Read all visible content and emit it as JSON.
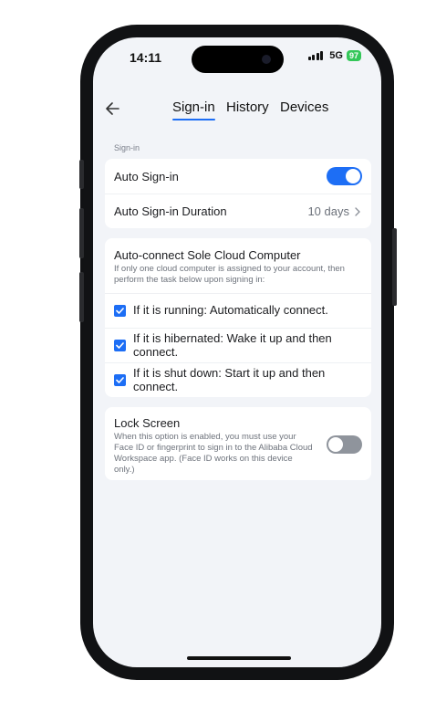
{
  "status_bar": {
    "time": "14:11",
    "network": "5G",
    "battery": "97"
  },
  "nav": {
    "back_icon": "arrow-left-icon",
    "tabs": [
      {
        "label": "Sign-in",
        "active": true
      },
      {
        "label": "History",
        "active": false
      },
      {
        "label": "Devices",
        "active": false
      }
    ]
  },
  "signin": {
    "section_label": "Sign-in",
    "auto_signin": {
      "label": "Auto Sign-in",
      "enabled": true
    },
    "duration": {
      "label": "Auto Sign-in Duration",
      "value": "10 days"
    }
  },
  "auto_connect": {
    "title": "Auto-connect Sole Cloud Computer",
    "description": "If only one cloud computer is assigned to your account, then perform the task below upon signing in:",
    "options": [
      {
        "label": "If it is running: Automatically connect.",
        "checked": true
      },
      {
        "label": "If it is hibernated: Wake it up and then connect.",
        "checked": true
      },
      {
        "label": "If it is shut down: Start it up and then connect.",
        "checked": true
      }
    ]
  },
  "lock_screen": {
    "title": "Lock Screen",
    "description": "When this option is enabled, you must use your Face ID or fingerprint to sign in to the Alibaba Cloud Workspace app. (Face ID works on this device only.)",
    "enabled": false
  },
  "colors": {
    "accent": "#1d6ef5",
    "background": "#f2f4f8",
    "battery": "#34c759"
  }
}
